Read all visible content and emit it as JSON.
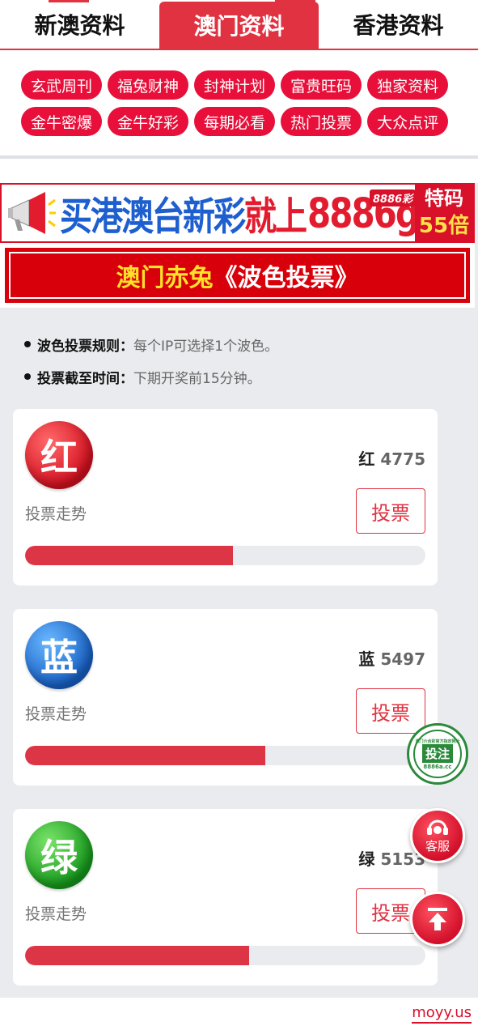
{
  "tabs": [
    {
      "label": "新澳资料",
      "active": false
    },
    {
      "label": "澳门资料",
      "active": true
    },
    {
      "label": "香港资料",
      "active": false
    }
  ],
  "links": [
    [
      "玄武周刊",
      "福兔财神",
      "封神计划",
      "富贵旺码",
      "独家资料"
    ],
    [
      "金牛密爆",
      "金牛好彩",
      "每期必看",
      "热门投票",
      "大众点评"
    ]
  ],
  "ad": {
    "text_blue": "买港澳台新彩",
    "text_red": "就上",
    "domain": "8886g.cc",
    "brand": "8886彩",
    "right_line1": "特码",
    "right_line2": "55倍"
  },
  "title": {
    "part1": "澳门赤兔",
    "part2": "《波色投票》"
  },
  "rules": [
    {
      "key": "波色投票规则：",
      "value": "每个IP可选择1个波色。"
    },
    {
      "key": "投票截至时间：",
      "value": "下期开奖前15分钟。"
    }
  ],
  "colors": {
    "accent": "#e03240",
    "bar": "#dc3545",
    "red": "#d41020",
    "blue": "#1760c4",
    "green": "#169a1c"
  },
  "cards": [
    {
      "ball": "红",
      "color": "red",
      "label": "红",
      "count": "4775",
      "trend": "投票走势",
      "button": "投票",
      "share": 0.52
    },
    {
      "ball": "蓝",
      "color": "blue",
      "label": "蓝",
      "count": "5497",
      "trend": "投票走势",
      "button": "投票",
      "share": 0.6
    },
    {
      "ball": "绿",
      "color": "green",
      "label": "绿",
      "count": "5153",
      "trend": "投票走势",
      "button": "投票",
      "share": 0.56
    }
  ],
  "floating": {
    "bet": "投注",
    "bet_ring_text": "澳门六合彩官方指定网址",
    "bet_domain": "8886a.cc",
    "service": "客服"
  },
  "watermark": "moyy.us"
}
